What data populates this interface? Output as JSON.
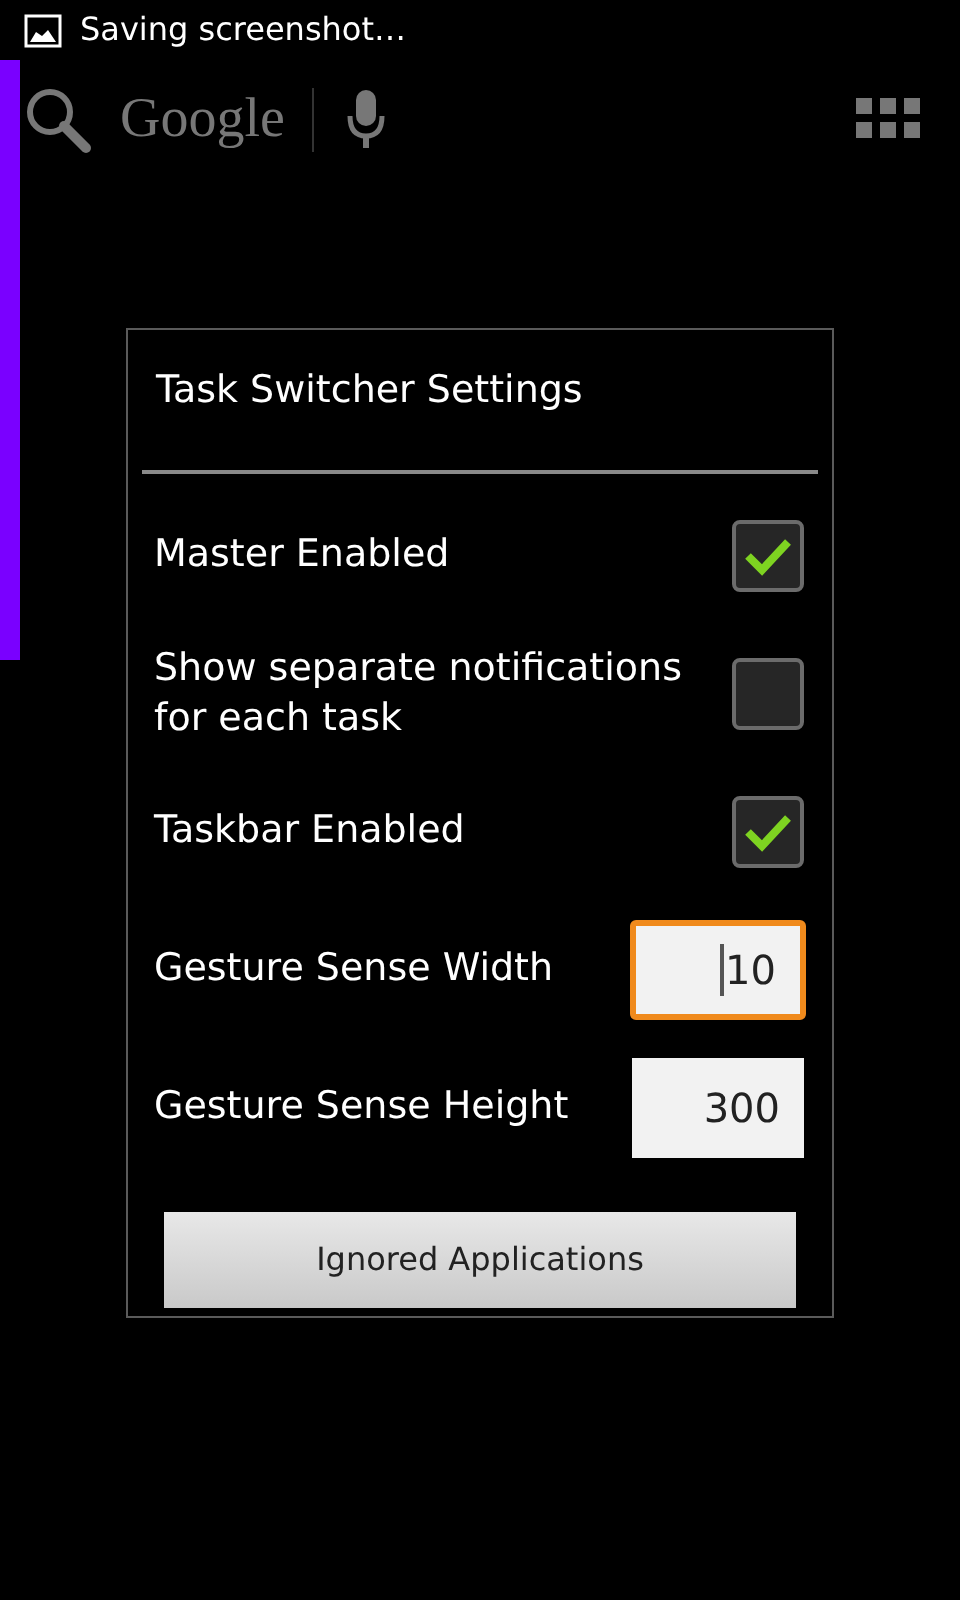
{
  "status_bar": {
    "notification": "Saving screenshot…"
  },
  "search_bar": {
    "logo_text": "Google"
  },
  "dialog": {
    "title": "Task Switcher Settings",
    "items": [
      {
        "kind": "checkbox",
        "label": "Master Enabled",
        "checked": true
      },
      {
        "kind": "checkbox",
        "label": "Show separate notifications for each task",
        "checked": false
      },
      {
        "kind": "checkbox",
        "label": "Taskbar Enabled",
        "checked": true
      },
      {
        "kind": "number",
        "label": "Gesture Sense Width",
        "value": "10",
        "focused": true
      },
      {
        "kind": "number",
        "label": "Gesture Sense Height",
        "value": "300",
        "focused": false
      }
    ],
    "button": "Ignored Applications"
  }
}
